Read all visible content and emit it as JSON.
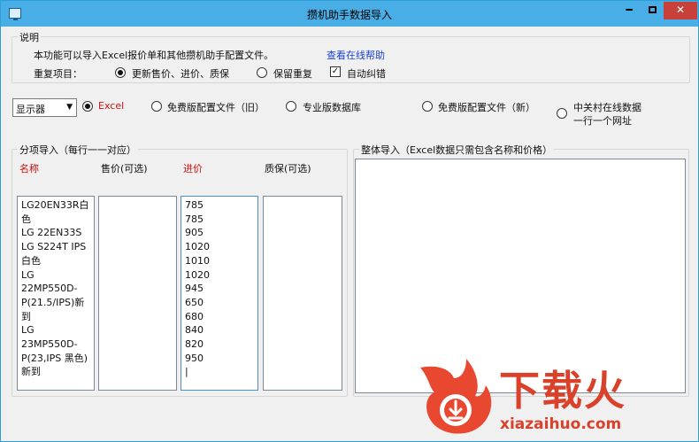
{
  "window": {
    "title": "攒机助手数据导入",
    "min_glyph": "━",
    "close_glyph": "✕"
  },
  "info": {
    "group_title": "说明",
    "description": "本功能可以导入Excel报价单和其他攒机助手配置文件。",
    "help_link": "查看在线帮助",
    "repeat_label": "重复项目：",
    "opt_update": "更新售价、进价、质保",
    "opt_keep": "保留重复",
    "auto_correct": "自动纠错",
    "auto_correct_checked": true
  },
  "source": {
    "category_selected": "显示器",
    "options": [
      "Excel",
      "免费版配置文件（旧）",
      "专业版数据库",
      "免费版配置文件（新）"
    ],
    "online_line1": "中关村在线数据",
    "online_line2": "一行一个网址",
    "selected_index": 0
  },
  "split_import": {
    "group_title": "分项导入（每行一一对应）",
    "col_name": "名称",
    "col_price": "售价(可选)",
    "col_cost": "进价",
    "col_warranty": "质保(可选)",
    "name_text": "LG20EN33R白色\nLG 22EN33S\nLG S224T IPS白色\nLG 22MP550D-P(21.5/IPS)新到\nLG 23MP550D-P(23,IPS 黑色)新到",
    "price_text": "",
    "cost_text": "785\n785\n905\n1020\n1010\n1020\n945\n650\n680\n840\n820\n950\n|",
    "warranty_text": ""
  },
  "whole_import": {
    "group_title": "整体导入（Excel数据只需包含名称和价格）",
    "text": ""
  },
  "watermark": {
    "brand": "下载火",
    "url": "xiazaihuo.com"
  },
  "colors": {
    "titlebar": "#4aaee6",
    "close": "#c7403a",
    "required": "#d01010",
    "link": "#1a3fd6",
    "brand": "#d9412b"
  }
}
